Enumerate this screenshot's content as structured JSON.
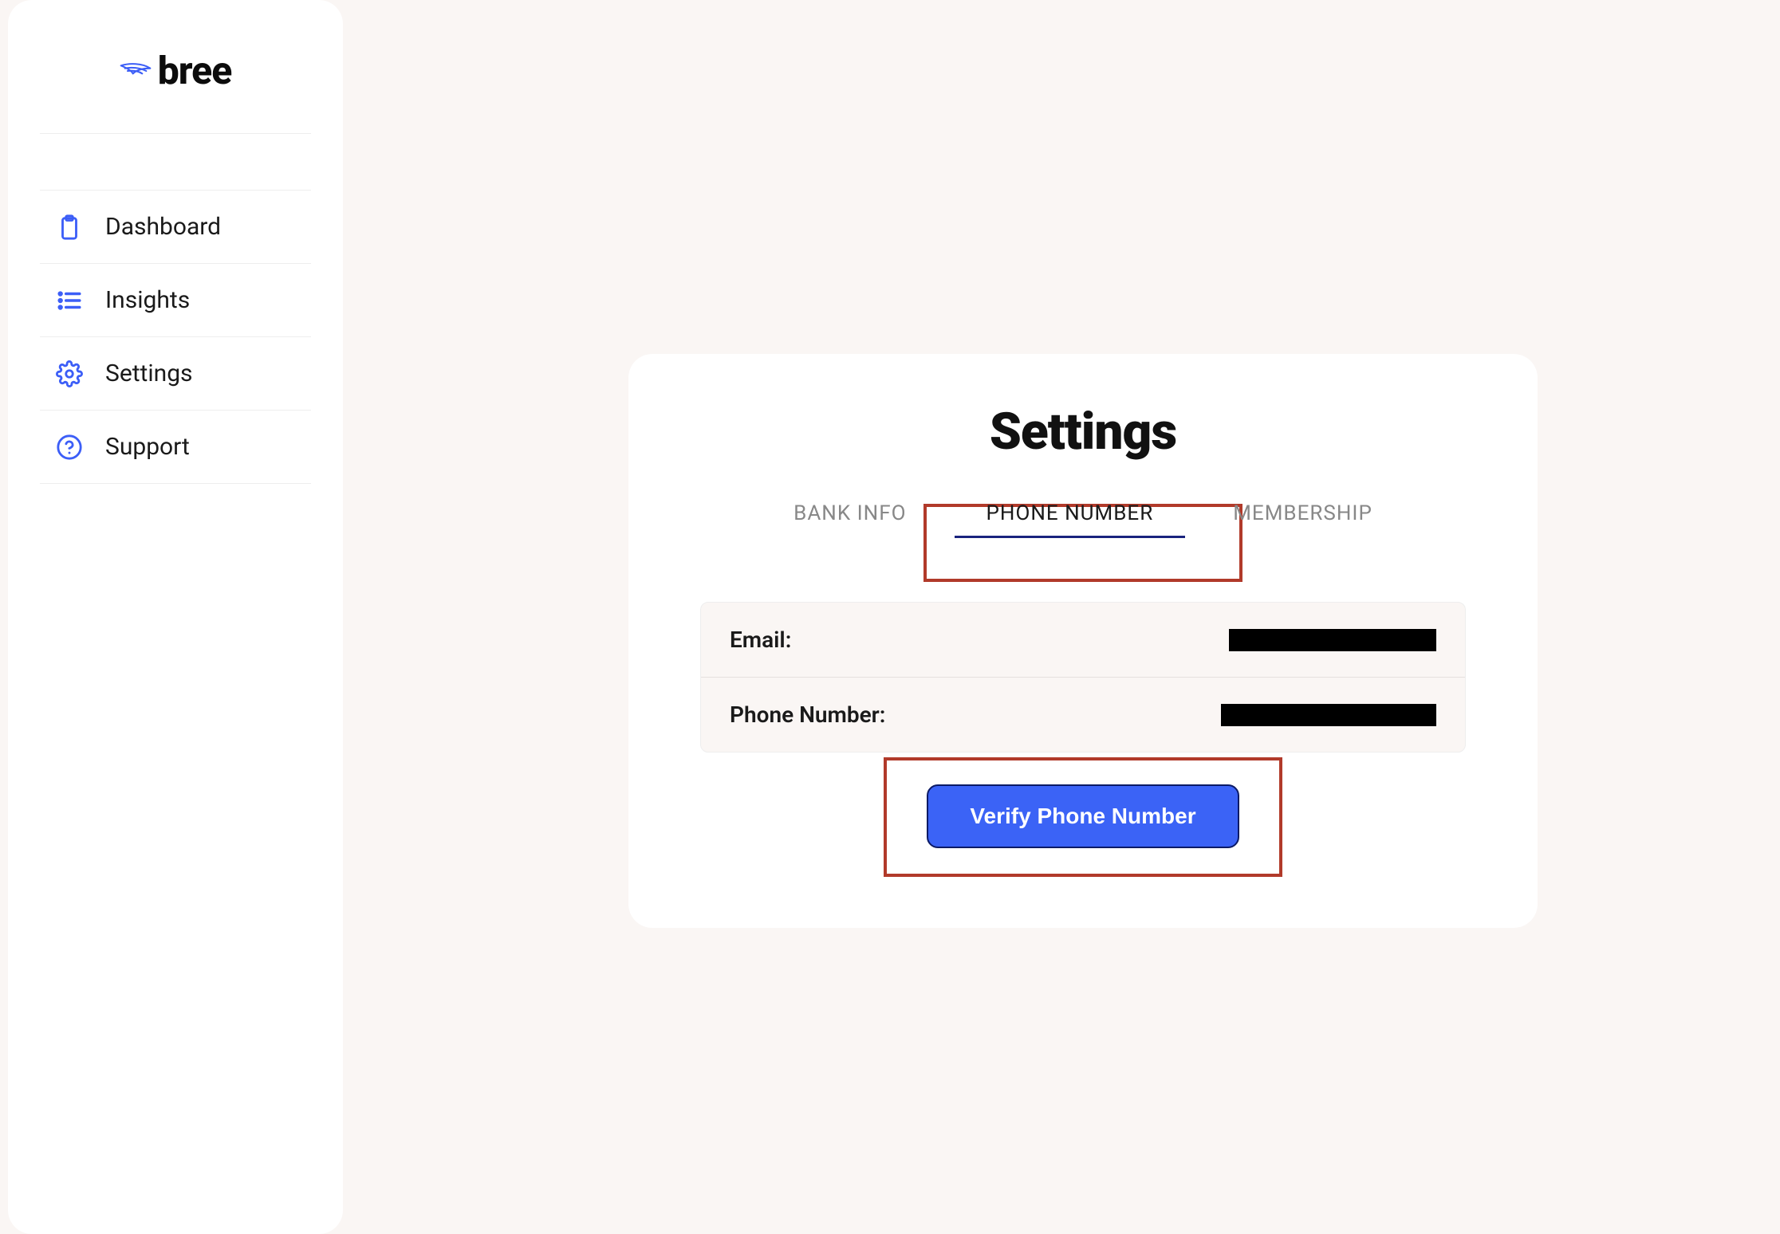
{
  "brand": {
    "name": "bree"
  },
  "sidebar": {
    "items": [
      {
        "label": "Dashboard"
      },
      {
        "label": "Insights"
      },
      {
        "label": "Settings"
      },
      {
        "label": "Support"
      }
    ]
  },
  "main": {
    "title": "Settings",
    "tabs": [
      {
        "label": "BANK INFO",
        "active": false
      },
      {
        "label": "PHONE NUMBER",
        "active": true
      },
      {
        "label": "MEMBERSHIP",
        "active": false
      }
    ],
    "fields": {
      "email_label": "Email:",
      "phone_label": "Phone Number:"
    },
    "verify_button": "Verify Phone Number"
  }
}
